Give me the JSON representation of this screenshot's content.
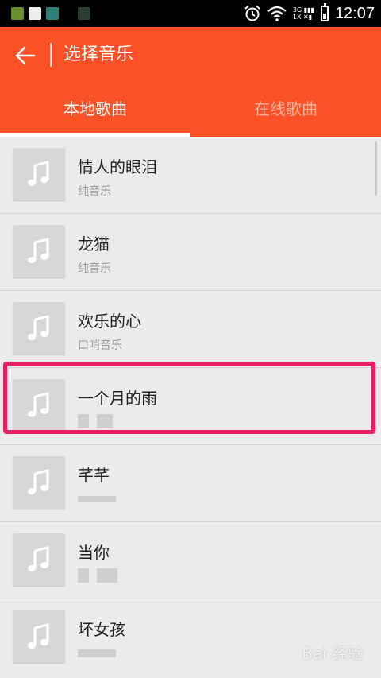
{
  "status_bar": {
    "time": "12:07",
    "network_top": "3G",
    "network_bottom": "1X",
    "icons": [
      "alarm-icon",
      "wifi-icon",
      "signal-icon",
      "battery-icon"
    ]
  },
  "app_bar": {
    "back_icon": "arrow-left-icon",
    "title": "选择音乐"
  },
  "tabs": [
    {
      "label": "本地歌曲",
      "selected": true
    },
    {
      "label": "在线歌曲",
      "selected": false
    }
  ],
  "songs": [
    {
      "title": "情人的眼泪",
      "artist": "纯音乐"
    },
    {
      "title": "龙猫",
      "artist": "纯音乐"
    },
    {
      "title": "欢乐的心",
      "artist": "口哨音乐"
    },
    {
      "title": "一个月的雨",
      "artist": ""
    },
    {
      "title": "芊芊",
      "artist": ""
    },
    {
      "title": "当你",
      "artist": ""
    },
    {
      "title": "坏女孩",
      "artist": ""
    }
  ],
  "watermark": "Bai 经验",
  "colors": {
    "accent": "#fb5126",
    "highlight": "#e91f63"
  }
}
